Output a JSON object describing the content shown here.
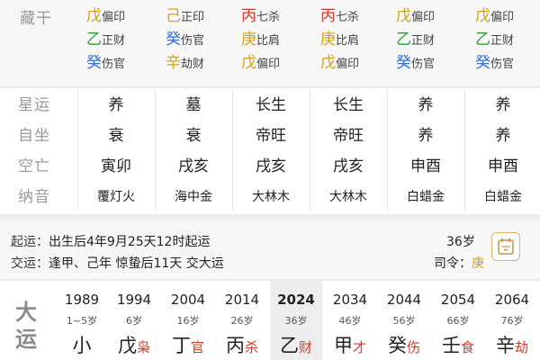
{
  "canggan": {
    "label": "藏干",
    "columns": [
      [
        {
          "stem": "戊",
          "god": "偏印",
          "color": "#d4a017"
        },
        {
          "stem": "乙",
          "god": "正财",
          "color": "#2e9b3a"
        },
        {
          "stem": "癸",
          "god": "伤官",
          "color": "#2f6fd6"
        }
      ],
      [
        {
          "stem": "己",
          "god": "正印",
          "color": "#d4a017"
        },
        {
          "stem": "癸",
          "god": "伤官",
          "color": "#2f6fd6"
        },
        {
          "stem": "辛",
          "god": "劫财",
          "color": "#d4a017"
        }
      ],
      [
        {
          "stem": "丙",
          "god": "七杀",
          "color": "#d23b2a"
        },
        {
          "stem": "庚",
          "god": "比肩",
          "color": "#d4a017"
        },
        {
          "stem": "戊",
          "god": "偏印",
          "color": "#d4a017"
        }
      ],
      [
        {
          "stem": "丙",
          "god": "七杀",
          "color": "#d23b2a"
        },
        {
          "stem": "庚",
          "god": "比肩",
          "color": "#d4a017"
        },
        {
          "stem": "戊",
          "god": "偏印",
          "color": "#d4a017"
        }
      ],
      [
        {
          "stem": "戊",
          "god": "偏印",
          "color": "#d4a017"
        },
        {
          "stem": "乙",
          "god": "正财",
          "color": "#2e9b3a"
        },
        {
          "stem": "癸",
          "god": "伤官",
          "color": "#2f6fd6"
        }
      ],
      [
        {
          "stem": "戊",
          "god": "偏印",
          "color": "#d4a017"
        },
        {
          "stem": "乙",
          "god": "正财",
          "color": "#2e9b3a"
        },
        {
          "stem": "癸",
          "god": "伤官",
          "color": "#2f6fd6"
        }
      ]
    ]
  },
  "star_rows": [
    {
      "label": "星运",
      "cells": [
        "养",
        "墓",
        "长生",
        "长生",
        "养",
        "养"
      ]
    },
    {
      "label": "自坐",
      "cells": [
        "衰",
        "衰",
        "帝旺",
        "帝旺",
        "养",
        "养"
      ]
    },
    {
      "label": "空亡",
      "cells": [
        "寅卯",
        "戌亥",
        "戌亥",
        "戌亥",
        "申酉",
        "申酉"
      ]
    },
    {
      "label": "纳音",
      "cells": [
        "覆灯火",
        "海中金",
        "大林木",
        "大林木",
        "白蜡金",
        "白蜡金"
      ]
    }
  ],
  "qiyun": {
    "qiyun_label": "起运：",
    "qiyun_value": "出生后4年9月25天12时起运",
    "jiaoyun_label": "交运：",
    "jiaoyun_value": "逢甲、己年 惊蛰后11天 交大运",
    "age": "36岁",
    "siling_label": "司令：",
    "siling_value": "庚",
    "siling_color": "#d4a017"
  },
  "dayun": {
    "label_chars": [
      "大",
      "运"
    ],
    "active_index": 4,
    "items": [
      {
        "year": "1989",
        "age": "1~5岁",
        "stem": "小",
        "god": "",
        "stem_color": "#222222",
        "god_color": "#222222"
      },
      {
        "year": "1994",
        "age": "6岁",
        "stem": "戊",
        "god": "枭",
        "stem_color": "#222222",
        "god_color": "#d23b2a"
      },
      {
        "year": "2004",
        "age": "16岁",
        "stem": "丁",
        "god": "官",
        "stem_color": "#222222",
        "god_color": "#d23b2a"
      },
      {
        "year": "2014",
        "age": "26岁",
        "stem": "丙",
        "god": "杀",
        "stem_color": "#222222",
        "god_color": "#d23b2a"
      },
      {
        "year": "2024",
        "age": "36岁",
        "stem": "乙",
        "god": "财",
        "stem_color": "#222222",
        "god_color": "#d23b2a"
      },
      {
        "year": "2034",
        "age": "46岁",
        "stem": "甲",
        "god": "才",
        "stem_color": "#222222",
        "god_color": "#d23b2a"
      },
      {
        "year": "2044",
        "age": "56岁",
        "stem": "癸",
        "god": "伤",
        "stem_color": "#222222",
        "god_color": "#d23b2a"
      },
      {
        "year": "2054",
        "age": "66岁",
        "stem": "壬",
        "god": "食",
        "stem_color": "#222222",
        "god_color": "#d23b2a"
      },
      {
        "year": "2064",
        "age": "76岁",
        "stem": "辛",
        "god": "劫",
        "stem_color": "#222222",
        "god_color": "#d23b2a"
      }
    ]
  }
}
